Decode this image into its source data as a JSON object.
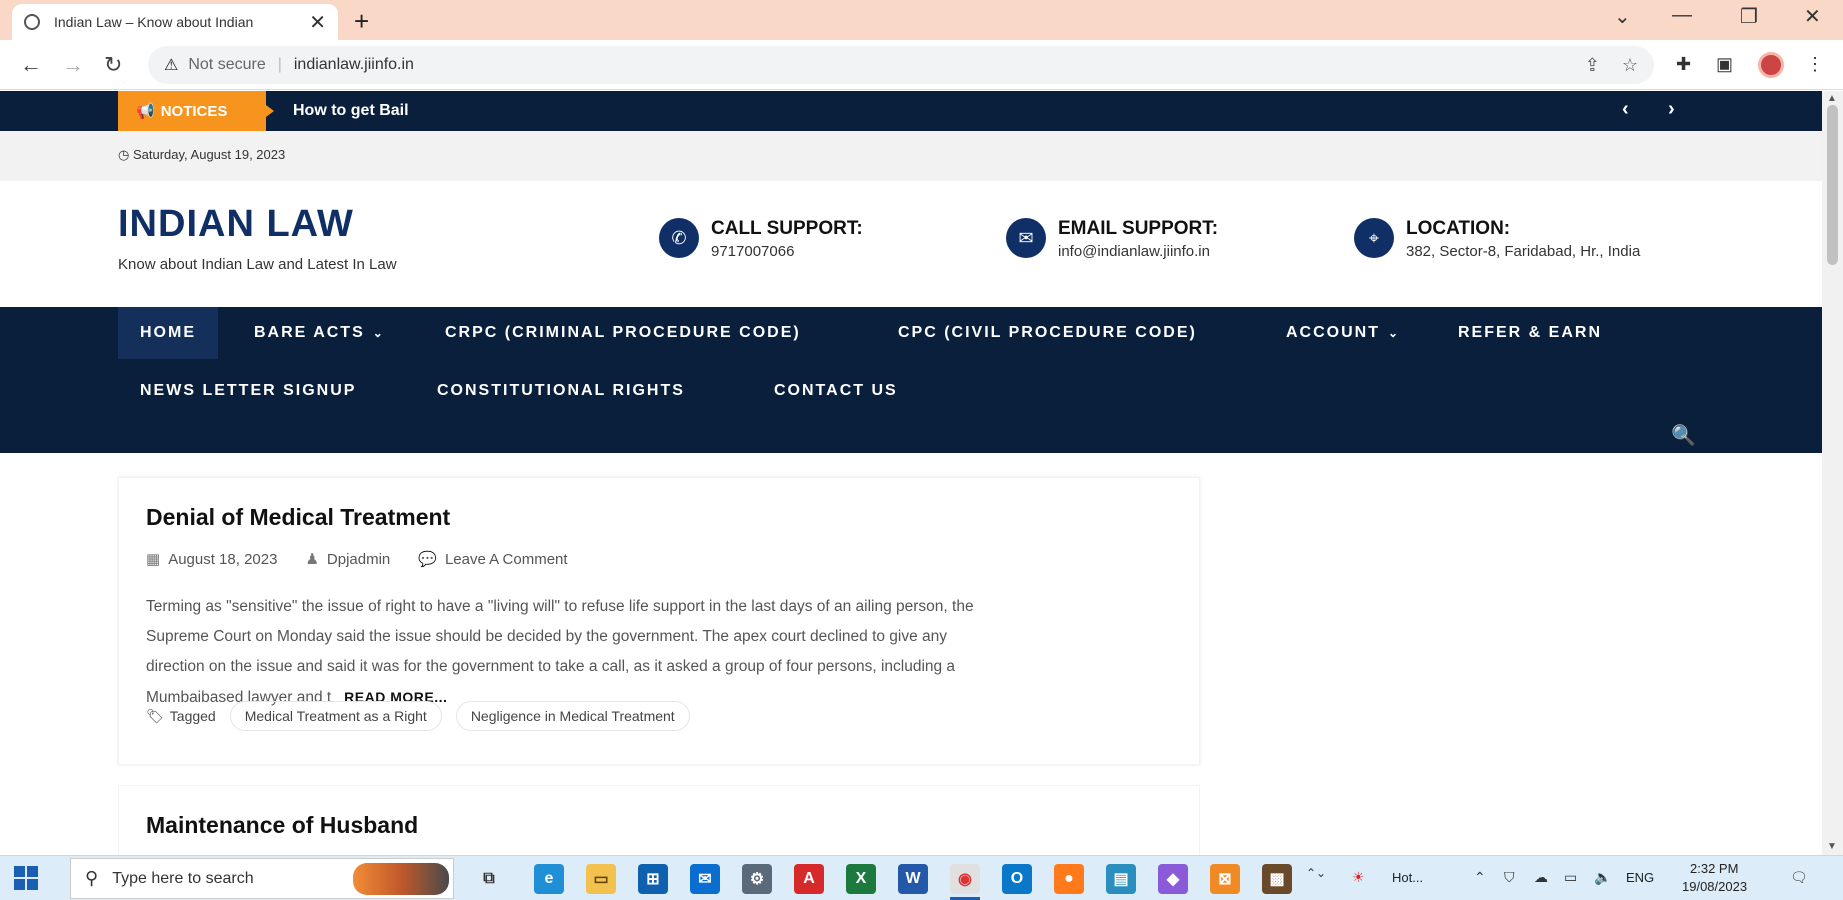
{
  "browser": {
    "tab_title": "Indian Law – Know about Indian",
    "tab_close": "✕",
    "new_tab": "+",
    "window_controls": [
      "⌄",
      "—",
      "❐",
      "✕"
    ],
    "security_label": "Not secure",
    "url": "indianlaw.jiinfo.in",
    "icons": [
      "back-icon",
      "forward-icon",
      "reload-icon",
      "share-icon",
      "star-icon",
      "extensions-icon",
      "sidepanel-icon",
      "profile-avatar",
      "menu-icon"
    ]
  },
  "notice": {
    "badge": "NOTICES",
    "text": "How to get Bail"
  },
  "date": "Saturday, August 19, 2023",
  "site": {
    "title": "INDIAN LAW",
    "tagline": "Know about Indian Law and Latest In Law"
  },
  "contacts": [
    {
      "label": "CALL SUPPORT:",
      "value": "9717007066",
      "icon": "phone-icon"
    },
    {
      "label": "EMAIL SUPPORT:",
      "value": "info@indianlaw.jiinfo.in",
      "icon": "envelope-icon"
    },
    {
      "label": "LOCATION:",
      "value": "382, Sector-8, Faridabad, Hr., India",
      "icon": "location-pin-icon"
    }
  ],
  "nav": [
    {
      "label": "HOME",
      "active": true
    },
    {
      "label": "BARE ACTS",
      "dropdown": true
    },
    {
      "label": "CRPC (CRIMINAL PROCEDURE CODE)"
    },
    {
      "label": "CPC (CIVIL PROCEDURE CODE)"
    },
    {
      "label": "ACCOUNT",
      "dropdown": true
    },
    {
      "label": "REFER & EARN"
    },
    {
      "label": "NEWS LETTER SIGNUP"
    },
    {
      "label": "CONSTITUTIONAL RIGHTS"
    },
    {
      "label": "CONTACT US"
    }
  ],
  "posts": [
    {
      "title": "Denial of Medical Treatment",
      "date": "August 18, 2023",
      "author": "Dpjadmin",
      "comments": "Leave A Comment",
      "excerpt_lines": [
        "Terming as \"sensitive\" the issue of right to have a \"living will\" to refuse life support in the last days of an ailing person, the",
        "Supreme Court on Monday said the issue should be decided by the government. The apex court declined to give any",
        "direction on the issue and said it was for the government to take a call, as it asked a group of four persons, including a",
        "Mumbaibased lawyer and t"
      ],
      "read_more": "READ MORE...",
      "tagged_label": "Tagged",
      "tags": [
        "Medical Treatment as a Right",
        "Negligence in Medical Treatment"
      ]
    },
    {
      "title": "Maintenance of Husband"
    }
  ],
  "taskbar": {
    "search_placeholder": "Type here to search",
    "weather": "Hot...",
    "lang": "ENG",
    "time": "2:32 PM",
    "date": "19/08/2023"
  }
}
